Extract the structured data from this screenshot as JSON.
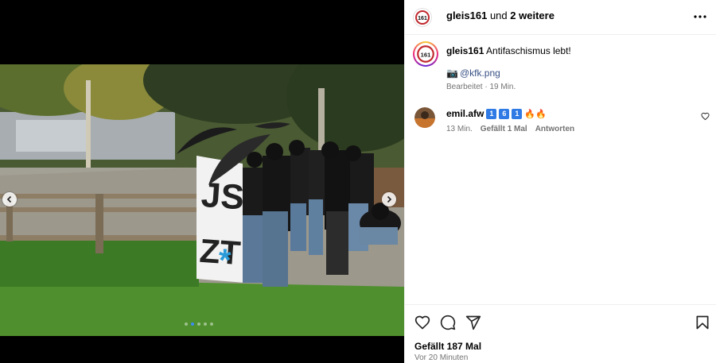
{
  "header": {
    "username": "gleis161",
    "connector": "und",
    "others": "2 weitere"
  },
  "caption": {
    "username": "gleis161",
    "text": "Antifaschismus lebt!",
    "link_emoji": "📷",
    "link": "@kfk.png",
    "meta": "Bearbeitet · 19 Min."
  },
  "comment": {
    "username": "emil.afw",
    "badges": [
      "1",
      "6",
      "1"
    ],
    "flames": "🔥🔥",
    "time": "13 Min.",
    "likes": "Gefällt 1 Mal",
    "reply": "Antworten"
  },
  "likes": "Gefällt 187 Mal",
  "ago": "Vor 20 Minuten",
  "banner_text": "JST ZT*",
  "carousel": {
    "count": 5,
    "active": 1
  },
  "colors": {
    "link": "#385185",
    "muted": "#737373",
    "badge": "#2f7ae5",
    "active_dot": "#3b8bf5"
  },
  "icons": [
    "more-icon",
    "heart-icon",
    "comment-icon",
    "share-icon",
    "bookmark-icon",
    "chevron-left-icon",
    "chevron-right-icon"
  ]
}
